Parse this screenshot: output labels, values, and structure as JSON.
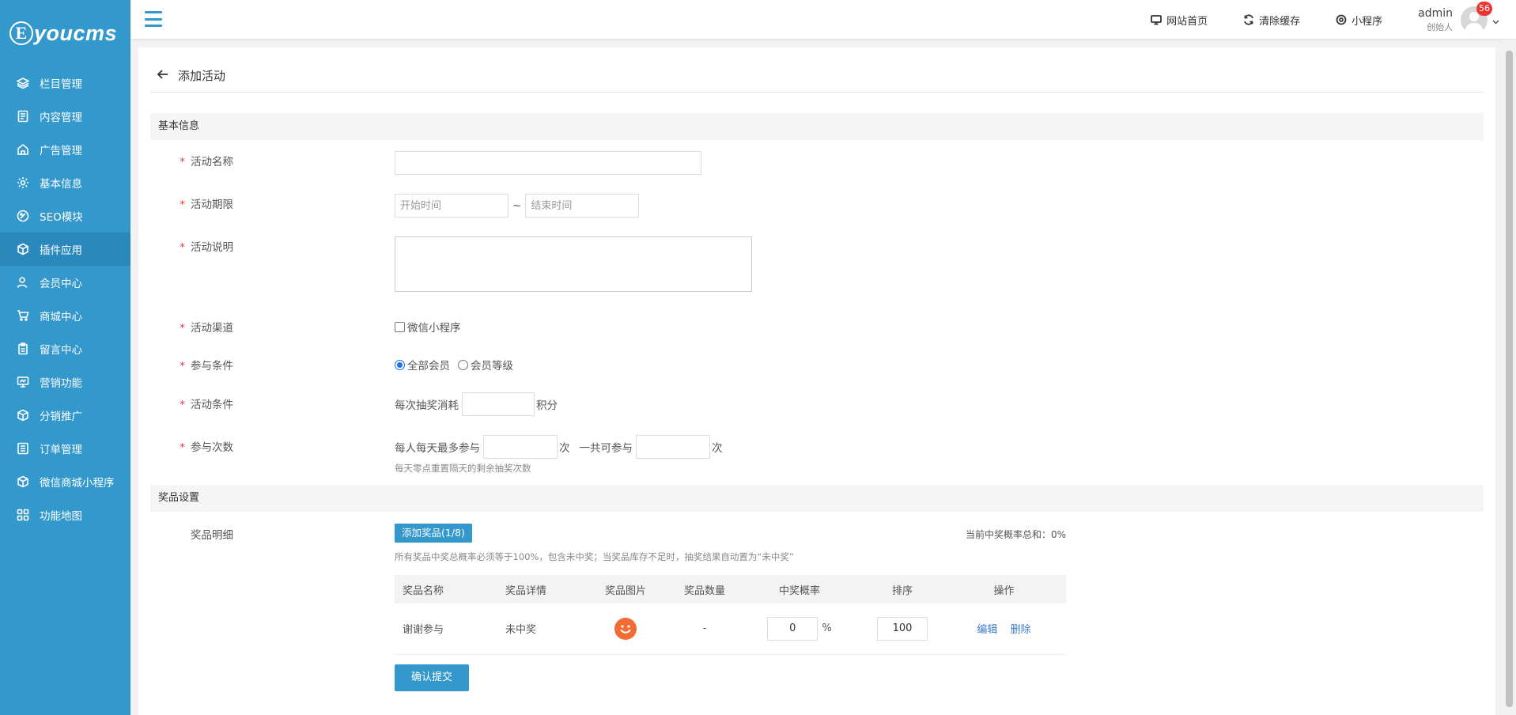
{
  "brand": {
    "logo_letter": "E",
    "logo_text": "youcms",
    "color": "#3398cc"
  },
  "sidebar": {
    "items": [
      {
        "label": "栏目管理",
        "icon": "layers-icon"
      },
      {
        "label": "内容管理",
        "icon": "document-icon"
      },
      {
        "label": "广告管理",
        "icon": "house-icon"
      },
      {
        "label": "基本信息",
        "icon": "gear-icon"
      },
      {
        "label": "SEO模块",
        "icon": "seo-icon"
      },
      {
        "label": "插件应用",
        "icon": "cube-icon",
        "active": true
      },
      {
        "label": "会员中心",
        "icon": "user-icon"
      },
      {
        "label": "商城中心",
        "icon": "cart-icon"
      },
      {
        "label": "留言中心",
        "icon": "clipboard-icon"
      },
      {
        "label": "营销功能",
        "icon": "monitor-icon"
      },
      {
        "label": "分销推广",
        "icon": "cube-icon"
      },
      {
        "label": "订单管理",
        "icon": "list-icon"
      },
      {
        "label": "微信商城小程序",
        "icon": "cube-icon"
      },
      {
        "label": "功能地图",
        "icon": "grid-icon"
      }
    ]
  },
  "topbar": {
    "links": [
      {
        "label": "网站首页",
        "icon": "monitor-icon"
      },
      {
        "label": "清除缓存",
        "icon": "refresh-icon"
      },
      {
        "label": "小程序",
        "icon": "miniapp-icon"
      }
    ],
    "user": {
      "name": "admin",
      "role": "创始人",
      "badge": "56"
    }
  },
  "page": {
    "title": "添加活动"
  },
  "sections": {
    "basic": "基本信息",
    "prize": "奖品设置"
  },
  "form": {
    "name": {
      "label": "活动名称",
      "value": ""
    },
    "period": {
      "label": "活动期限",
      "start_placeholder": "开始时间",
      "sep": "~",
      "end_placeholder": "结束时间"
    },
    "desc": {
      "label": "活动说明",
      "value": ""
    },
    "channel": {
      "label": "活动渠道",
      "option": "微信小程序",
      "checked": false
    },
    "condition": {
      "label": "参与条件",
      "options": [
        "全部会员",
        "会员等级"
      ],
      "selected": "全部会员"
    },
    "cost": {
      "label": "活动条件",
      "prefix": "每次抽奖消耗",
      "value": "",
      "suffix": "积分"
    },
    "times": {
      "label": "参与次数",
      "prefix1": "每人每天最多参与",
      "value1": "",
      "unit1": "次",
      "prefix2": "一共可参与",
      "value2": "",
      "unit2": "次",
      "hint": "每天零点重置隔天的剩余抽奖次数"
    }
  },
  "prize": {
    "label": "奖品明细",
    "add_button": "添加奖品(1/8)",
    "total_prob": "当前中奖概率总和：0%",
    "hint": "所有奖品中奖总概率必须等于100%，包含未中奖；当奖品库存不足时，抽奖结果自动置为“未中奖”",
    "columns": [
      "奖品名称",
      "奖品详情",
      "奖品图片",
      "奖品数量",
      "中奖概率",
      "排序",
      "操作"
    ],
    "rows": [
      {
        "name": "谢谢参与",
        "detail": "未中奖",
        "image": "smiley-icon",
        "qty": "-",
        "prob": "0",
        "prob_unit": "%",
        "sort": "100",
        "edit": "编辑",
        "delete": "删除"
      }
    ]
  },
  "submit": "确认提交"
}
